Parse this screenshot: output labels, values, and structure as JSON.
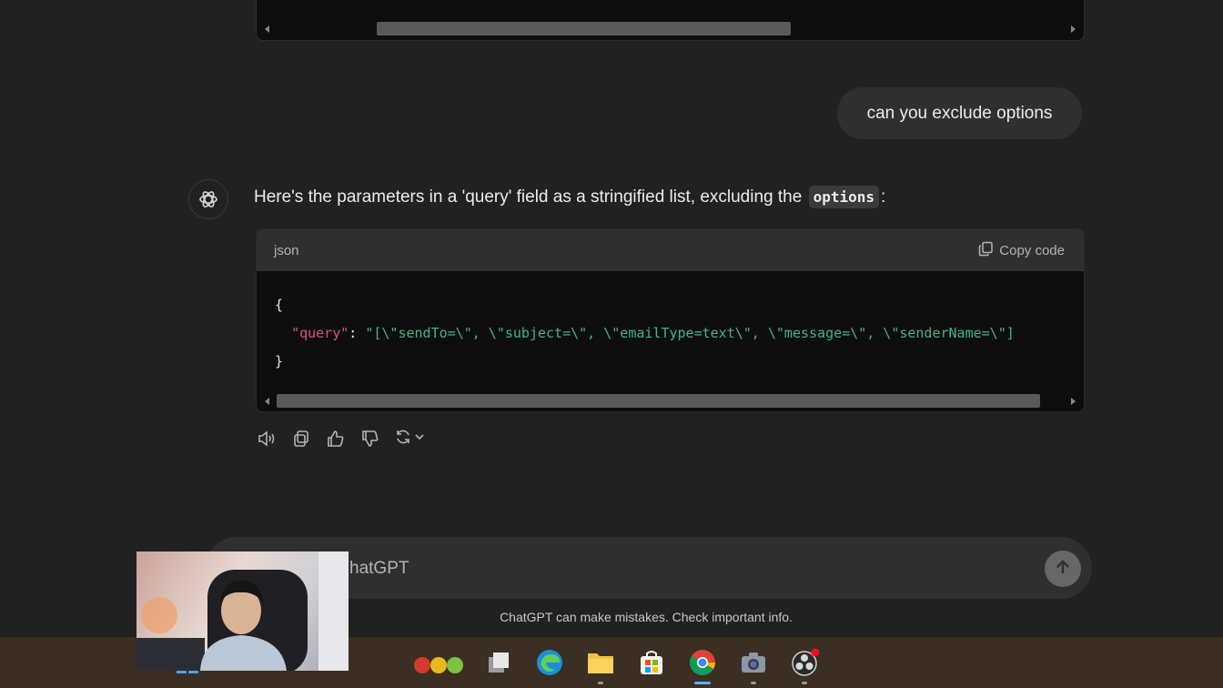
{
  "conversation": {
    "user_message": "can you exclude options",
    "assistant_intro_before": "Here's the parameters in a 'query' field as a stringified list, excluding the",
    "assistant_inline_code": "options",
    "assistant_intro_after": ":"
  },
  "code_block": {
    "language": "json",
    "copy_label": "Copy code",
    "line1": "{",
    "key": "\"query\"",
    "colon": ": ",
    "value": "\"[\\\"sendTo=\\\", \\\"subject=\\\", \\\"emailType=text\\\", \\\"message=\\\", \\\"senderName=\\\"]",
    "line3": "}"
  },
  "input": {
    "placeholder_visible": "hatGPT"
  },
  "footer": {
    "disclaimer": "ChatGPT can make mistakes. Check important info."
  },
  "icons": {
    "actions": [
      "speaker-icon",
      "copy-icon",
      "thumbs-up-icon",
      "thumbs-down-icon",
      "regenerate-icon",
      "chevron-down-icon"
    ],
    "taskbar": [
      "start-icon",
      "widgets-icon",
      "task-view-icon",
      "edge-icon",
      "file-explorer-icon",
      "store-icon",
      "chrome-icon",
      "camera-icon",
      "obs-icon"
    ]
  },
  "colors": {
    "background": "#212121",
    "code_background": "#0d0d0d",
    "json_key": "#e0527b",
    "json_string": "#3fb68b",
    "taskbar": "#3b2e22"
  }
}
